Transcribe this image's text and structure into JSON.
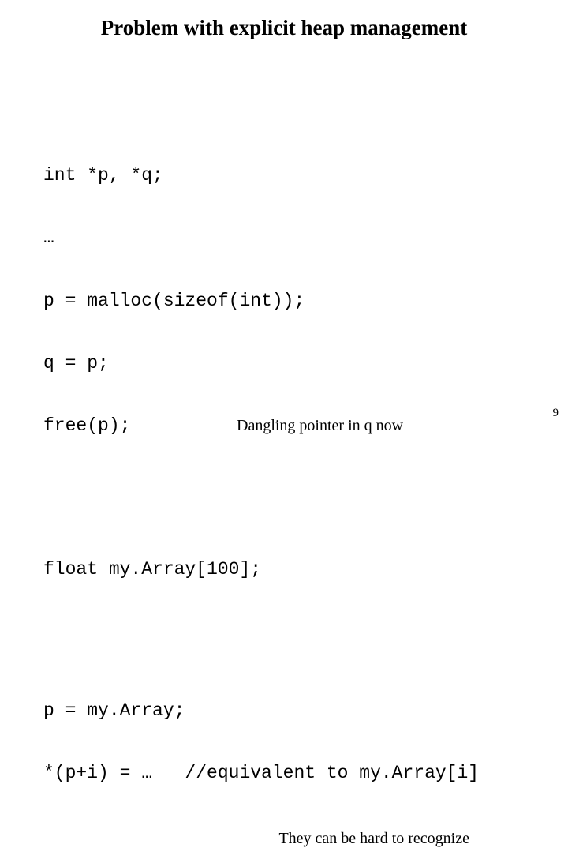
{
  "title": "Problem with explicit heap management",
  "code1": {
    "line1": "int *p, *q;",
    "line2": "…",
    "line3": "p = malloc(sizeof(int));",
    "line4": "q = p;",
    "line5": "free(p);",
    "annotation1": "Dangling pointer in q now"
  },
  "code2": {
    "line1": "float my.Array[100];"
  },
  "code3": {
    "line1": "p = my.Array;",
    "line2": "*(p+i) = …   //equivalent to my.Array[i]"
  },
  "annotation2": "They can be hard to recognize",
  "page_number": "9"
}
